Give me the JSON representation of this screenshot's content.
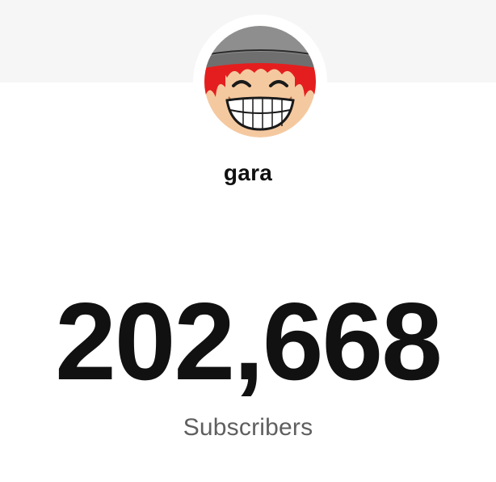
{
  "channel": {
    "name": "gara",
    "avatar_icon": "grinning-cartoon-face-avatar"
  },
  "stats": {
    "subscriber_count": "202,668",
    "subscriber_label": "Subscribers"
  },
  "colors": {
    "background": "#ffffff",
    "banner": "#f6f6f6",
    "count_text": "#111111",
    "label_text": "#5f5f5f"
  }
}
